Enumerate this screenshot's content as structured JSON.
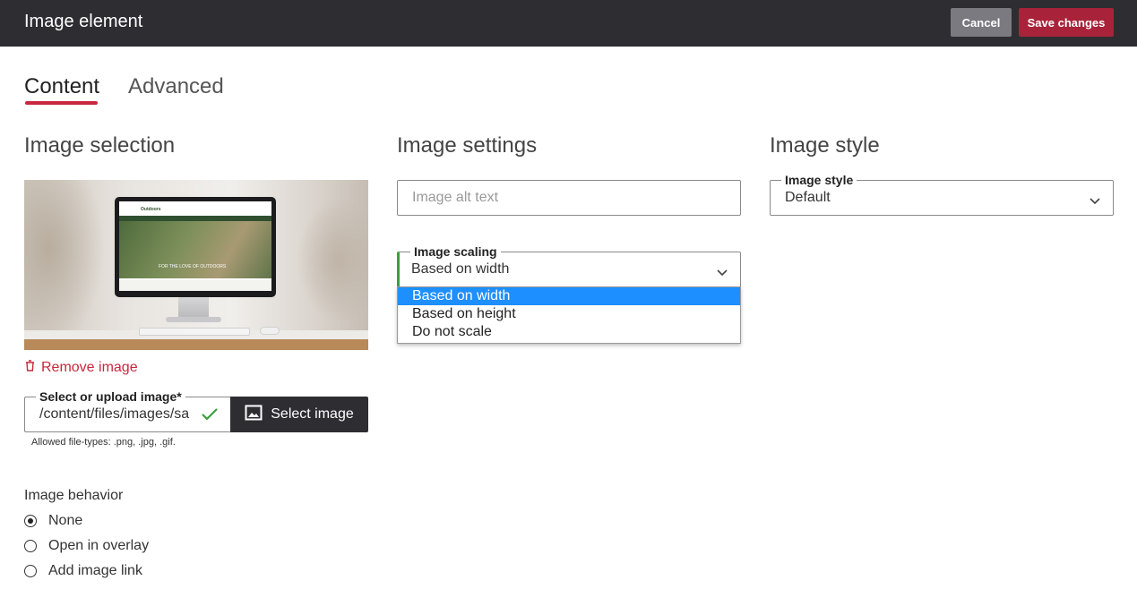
{
  "header": {
    "title": "Image element",
    "cancel_label": "Cancel",
    "save_label": "Save changes",
    "background": "#2e2d32",
    "save_color": "#a8233a"
  },
  "tabs": [
    {
      "label": "Content",
      "active": true
    },
    {
      "label": "Advanced",
      "active": false
    }
  ],
  "accent_color": "#c8273e",
  "image_selection": {
    "title": "Image selection",
    "preview_screen_brand": "Outdoors",
    "preview_screen_tagline": "FOR THE LOVE OF OUTDOORS",
    "remove_label": "Remove image",
    "remove_icon": "trash-icon",
    "upload_legend": "Select or upload image*",
    "upload_value": "/content/files/images/sa",
    "upload_valid_icon": "checkmark-icon",
    "select_button_label": "Select image",
    "select_button_icon": "image-icon",
    "hint": "Allowed file-types: .png, .jpg, .gif.",
    "behavior_label": "Image behavior",
    "behavior_options": [
      {
        "label": "None",
        "checked": true
      },
      {
        "label": "Open in overlay",
        "checked": false
      },
      {
        "label": "Add image link",
        "checked": false
      }
    ]
  },
  "image_settings": {
    "title": "Image settings",
    "alt_placeholder": "Image alt text",
    "scaling_legend": "Image scaling",
    "scaling_value": "Based on width",
    "scaling_options": [
      {
        "label": "Based on width",
        "highlighted": true
      },
      {
        "label": "Based on height",
        "highlighted": false
      },
      {
        "label": "Do not scale",
        "highlighted": false
      }
    ]
  },
  "image_style": {
    "title": "Image style",
    "style_legend": "Image style",
    "style_value": "Default"
  }
}
